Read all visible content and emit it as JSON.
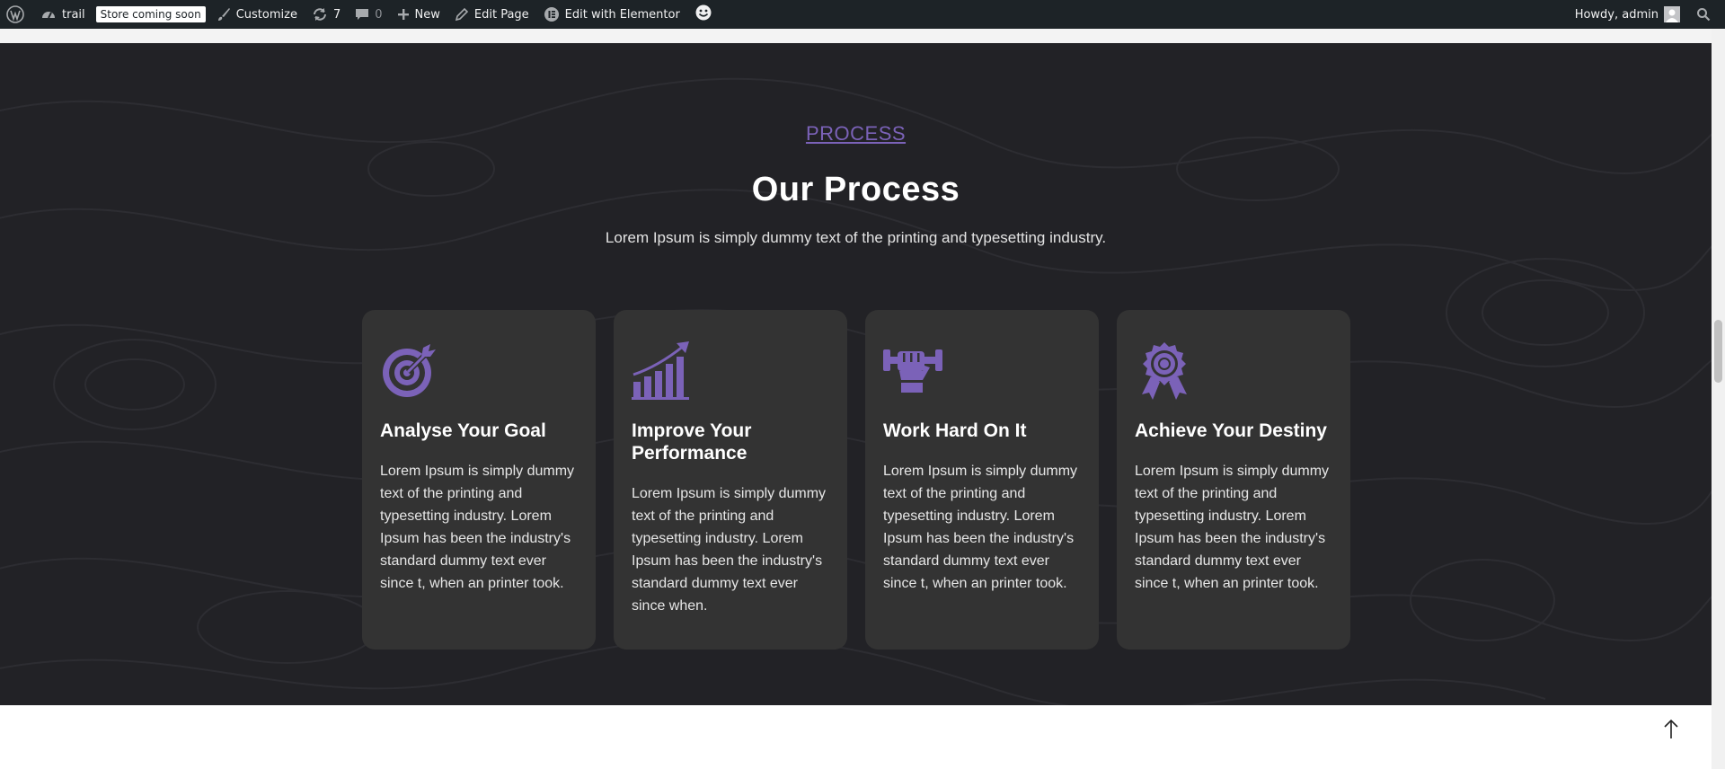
{
  "adminbar": {
    "site_name": "trail",
    "store_badge": "Store coming soon",
    "customize": "Customize",
    "updates_count": "7",
    "comments_count": "0",
    "new": "New",
    "edit_page": "Edit Page",
    "edit_elementor": "Edit with Elementor",
    "howdy": "Howdy, admin"
  },
  "section": {
    "eyebrow": "PROCESS",
    "title": "Our Process",
    "subtitle": "Lorem Ipsum is simply dummy text of the printing and typesetting industry."
  },
  "cards": [
    {
      "icon": "target-icon",
      "title": "Analyse Your Goal",
      "text": "Lorem Ipsum is simply dummy text of the printing and typesetting industry. Lorem Ipsum has been the industry's standard dummy text ever since t, when an printer took."
    },
    {
      "icon": "growth-chart-icon",
      "title": "Improve Your Performance",
      "text": "Lorem Ipsum is simply dummy text of the printing and typesetting industry. Lorem Ipsum has been the industry's standard dummy text ever since when."
    },
    {
      "icon": "dumbbell-fist-icon",
      "title": "Work Hard On It",
      "text": "Lorem Ipsum is simply dummy text of the printing and typesetting industry. Lorem Ipsum has been the industry's standard dummy text ever since t, when an printer took."
    },
    {
      "icon": "award-badge-icon",
      "title": "Achieve Your Destiny",
      "text": "Lorem Ipsum is simply dummy text of the printing and typesetting industry. Lorem Ipsum has been the industry's standard dummy text ever since t, when an printer took."
    }
  ],
  "colors": {
    "accent": "#7b62b8",
    "section_bg": "#222226",
    "card_bg": "#333333",
    "adminbar_bg": "#1d2327"
  }
}
